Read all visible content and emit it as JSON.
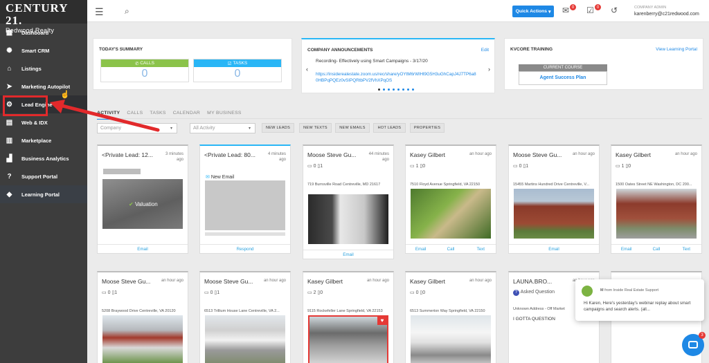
{
  "brand": {
    "name": "CENTURY 21.",
    "office": "Redwood Realty"
  },
  "sidebar": {
    "items": [
      {
        "label": "Dashboard",
        "icon": "dashboard-icon"
      },
      {
        "label": "Smart CRM",
        "icon": "crm-icon"
      },
      {
        "label": "Listings",
        "icon": "home-icon"
      },
      {
        "label": "Marketing Autopilot",
        "icon": "send-icon"
      },
      {
        "label": "Lead Engine",
        "icon": "gear-icon"
      },
      {
        "label": "Web & IDX",
        "icon": "web-icon"
      },
      {
        "label": "Marketplace",
        "icon": "store-icon"
      },
      {
        "label": "Business Analytics",
        "icon": "chart-icon"
      },
      {
        "label": "Support Portal",
        "icon": "help-icon"
      },
      {
        "label": "Learning Portal",
        "icon": "graduation-cap-icon"
      }
    ]
  },
  "topbar": {
    "quick_actions": "Quick Actions",
    "mail_count": "0",
    "tasks_count": "0",
    "account_role": "COMPANY ADMIN",
    "account_email": "karenberry@c21redwood.com"
  },
  "summary": {
    "title": "TODAY'S SUMMARY",
    "calls_label": "CALLS",
    "calls_value": "0",
    "tasks_label": "TASKS",
    "tasks_value": "0"
  },
  "announcements": {
    "title": "COMPANY ANNOUNCEMENTS",
    "edit": "Edit",
    "text": "Recording- Effectively using Smart Campaigns - 3/17/20",
    "link": "https://insiderealestate.zoom.us/rec/share/yOYtM6rWlHl9G5H3uGhCapJ4J7TP6a80HBPqPQEz0vSIPQRtbPV2fVhXPqOS"
  },
  "training": {
    "title": "KVCORE TRAINING",
    "link": "View Learning Portal",
    "current": "CURRENT COURSE",
    "course": "Agent Success Plan"
  },
  "tabs": [
    "ACTIVITY",
    "CALLS",
    "TASKS",
    "CALENDAR",
    "MY BUSINESS"
  ],
  "filters": {
    "company_placeholder": "Company",
    "activity": "All Activity",
    "buttons": [
      "NEW LEADS",
      "NEW TEXTS",
      "NEW EMAILS",
      "HOT LEADS",
      "PROPERTIES"
    ]
  },
  "cards_row1": [
    {
      "name": "<Private Lead: 12...",
      "time": "3 minutes ago",
      "info": "",
      "address": "",
      "badge": "Valuation",
      "actions": [
        "Email"
      ]
    },
    {
      "name": "<Private Lead: 80...",
      "time": "4 minutes ago",
      "info": "New Email",
      "address": "",
      "actions": [
        "Respond"
      ]
    },
    {
      "name": "Moose Steve Gu...",
      "time": "44 minutes ago",
      "info": "0 ▯1",
      "address": "719 Burnsville Road Centreville, MD 21617",
      "actions": [
        "Email"
      ]
    },
    {
      "name": "Kasey Gilbert",
      "time": "an hour ago",
      "info": "1 ▯0",
      "address": "7510 Floyd Avenue Springfield, VA 22150",
      "actions": [
        "Email",
        "Call",
        "Text"
      ]
    },
    {
      "name": "Moose Steve Gu...",
      "time": "an hour ago",
      "info": "0 ▯1",
      "address": "15455 Martins Hundred Drive Centreville, V...",
      "actions": [
        "Email"
      ]
    },
    {
      "name": "Kasey Gilbert",
      "time": "an hour ago",
      "info": "1 ▯0",
      "address": "1500 Oates Street NE Washington, DC 200...",
      "actions": [
        "Email",
        "Call",
        "Text"
      ]
    }
  ],
  "cards_row2": [
    {
      "name": "Moose Steve Gu...",
      "time": "an hour ago",
      "info": "0 ▯1",
      "address": "5208 Braywood Drive Centreville, VA 20120"
    },
    {
      "name": "Moose Steve Gu...",
      "time": "an hour ago",
      "info": "0 ▯1",
      "address": "6513 Trillium House Lane Centreville, VA 2..."
    },
    {
      "name": "Kasey Gilbert",
      "time": "an hour ago",
      "info": "2 ▯0",
      "address": "9115 Rockefeller Lane Springfield, VA 22153"
    },
    {
      "name": "Kasey Gilbert",
      "time": "an hour ago",
      "info": "0 ▯0",
      "address": "6513 Summerton Way Springfield, VA 22150"
    },
    {
      "name": "LAUNA.BRO...",
      "time": "an hour ago",
      "info": "Asked Question",
      "address": "Unknown Address - Off Market",
      "extra": "I GOTTA QUESTION"
    }
  ],
  "chat": {
    "sender": "M",
    "from": "from Inside Real Estate Support",
    "message": "Hi Karen, Here's yesterday's  webinar replay about smart campaigns and search alerts. (all...",
    "unread": "3"
  }
}
